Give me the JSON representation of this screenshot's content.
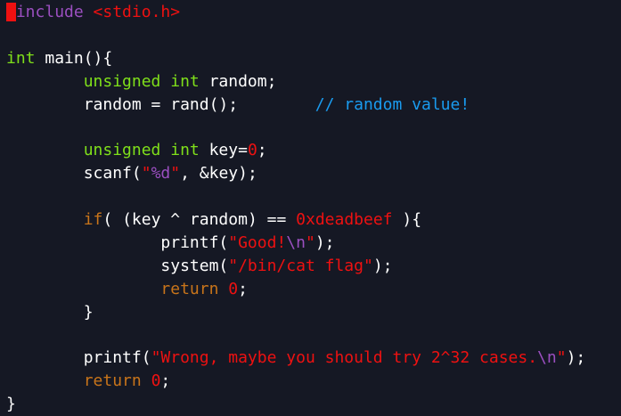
{
  "colors": {
    "background": "#151824",
    "cursor": "#ee1111",
    "preprocessor": "#9b4fc0",
    "string": "#ee1111",
    "type": "#7fdf1a",
    "keyword": "#c8741a",
    "comment": "#1a9bef"
  },
  "lines": [
    [
      [
        "#",
        "cursor"
      ],
      [
        "include",
        "pre"
      ],
      [
        " ",
        "plain"
      ],
      [
        "<stdio.h>",
        "str"
      ]
    ],
    [],
    [
      [
        "int",
        "type"
      ],
      [
        " main(){",
        "plain"
      ]
    ],
    [
      [
        "        ",
        "plain"
      ],
      [
        "unsigned int",
        "type"
      ],
      [
        " random;",
        "plain"
      ]
    ],
    [
      [
        "        random = rand();        ",
        "plain"
      ],
      [
        "// random value!",
        "com"
      ]
    ],
    [],
    [
      [
        "        ",
        "plain"
      ],
      [
        "unsigned int",
        "type"
      ],
      [
        " key=",
        "plain"
      ],
      [
        "0",
        "str"
      ],
      [
        ";",
        "plain"
      ]
    ],
    [
      [
        "        scanf(",
        "plain"
      ],
      [
        "\"",
        "str"
      ],
      [
        "%d",
        "esc"
      ],
      [
        "\"",
        "str"
      ],
      [
        ", &key);",
        "plain"
      ]
    ],
    [],
    [
      [
        "        ",
        "plain"
      ],
      [
        "if",
        "ctl"
      ],
      [
        "( (key ^ random) == ",
        "plain"
      ],
      [
        "0xdeadbeef",
        "str"
      ],
      [
        " ){",
        "plain"
      ]
    ],
    [
      [
        "                printf(",
        "plain"
      ],
      [
        "\"Good!",
        "str"
      ],
      [
        "\\n",
        "esc"
      ],
      [
        "\"",
        "str"
      ],
      [
        ");",
        "plain"
      ]
    ],
    [
      [
        "                system(",
        "plain"
      ],
      [
        "\"/bin/cat flag\"",
        "str"
      ],
      [
        ");",
        "plain"
      ]
    ],
    [
      [
        "                ",
        "plain"
      ],
      [
        "return",
        "ctl"
      ],
      [
        " ",
        "plain"
      ],
      [
        "0",
        "str"
      ],
      [
        ";",
        "plain"
      ]
    ],
    [
      [
        "        }",
        "plain"
      ]
    ],
    [],
    [
      [
        "        printf(",
        "plain"
      ],
      [
        "\"Wrong, maybe you should try 2^32 cases.",
        "str"
      ],
      [
        "\\n",
        "esc"
      ],
      [
        "\"",
        "str"
      ],
      [
        ");",
        "plain"
      ]
    ],
    [
      [
        "        ",
        "plain"
      ],
      [
        "return",
        "ctl"
      ],
      [
        " ",
        "plain"
      ],
      [
        "0",
        "str"
      ],
      [
        ";",
        "plain"
      ]
    ],
    [
      [
        "}",
        "plain"
      ]
    ]
  ]
}
